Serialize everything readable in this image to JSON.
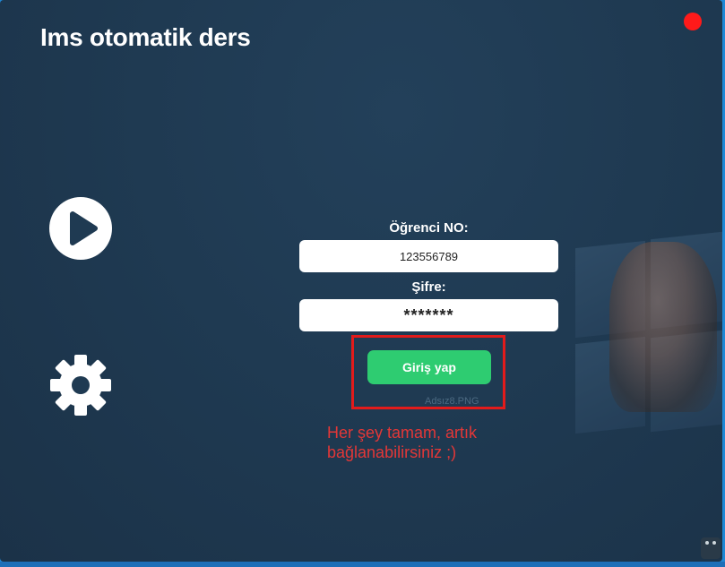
{
  "window": {
    "title": "Ims otomatik ders",
    "close_icon": "close-dot-icon"
  },
  "sidebar": {
    "play_icon": "play-icon",
    "settings_icon": "gear-icon"
  },
  "login_form": {
    "student_no_label": "Öğrenci NO:",
    "student_no_value": "123556789",
    "password_label": "Şifre:",
    "password_value": "*******",
    "submit_label": "Giriş yap"
  },
  "overlay": {
    "file_caption": "Adsız8.PNG",
    "annotation_text": "Her şey tamam, artık bağlanabilirsiniz ;)"
  },
  "colors": {
    "background": "#1f3a52",
    "accent_green": "#2ecc71",
    "close_red": "#ff1a1a",
    "annotation_red": "#e33737"
  }
}
